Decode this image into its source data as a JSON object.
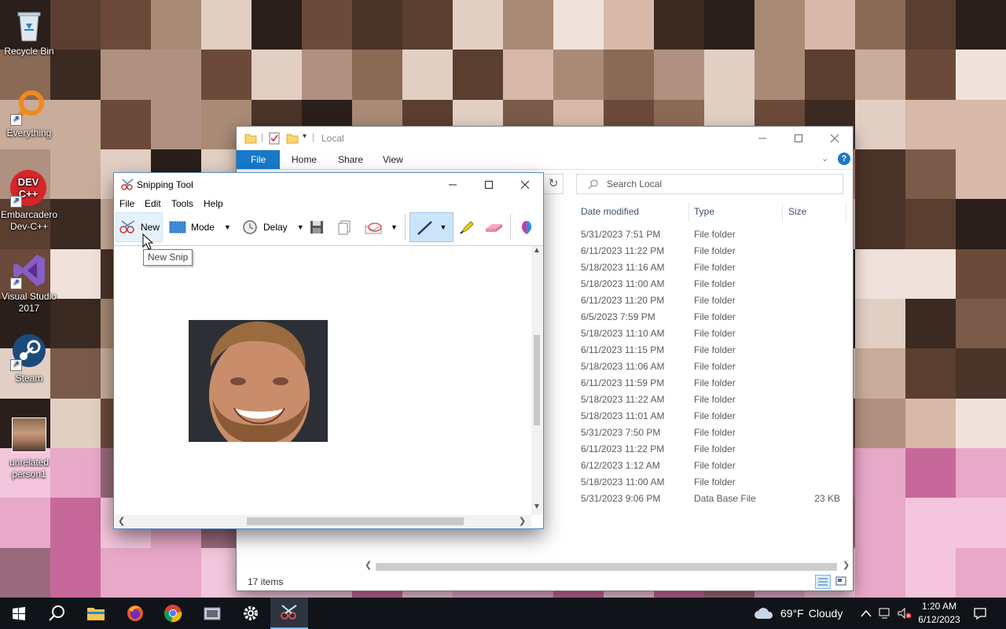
{
  "desktop": {
    "icons": [
      {
        "label": "Recycle Bin",
        "icon": "recycle-bin-icon"
      },
      {
        "label": "Everything",
        "icon": "everything-search-icon"
      },
      {
        "label": "Embarcadero Dev-C++",
        "icon": "devcpp-icon",
        "text": "DEV C++"
      },
      {
        "label": "Visual Studio 2017",
        "icon": "visual-studio-icon"
      },
      {
        "label": "Steam",
        "icon": "steam-icon"
      },
      {
        "label": "unrelated person1",
        "icon": "image-file-icon"
      }
    ]
  },
  "explorer": {
    "title": "Local",
    "ribbon_tabs": [
      "File",
      "Home",
      "Share",
      "View"
    ],
    "search_placeholder": "Search Local",
    "columns": [
      "Date modified",
      "Type",
      "Size"
    ],
    "rows": [
      {
        "date": "5/31/2023 7:51 PM",
        "type": "File folder",
        "size": ""
      },
      {
        "date": "6/11/2023 11:22 PM",
        "type": "File folder",
        "size": ""
      },
      {
        "date": "5/18/2023 11:16 AM",
        "type": "File folder",
        "size": ""
      },
      {
        "date": "5/18/2023 11:00 AM",
        "type": "File folder",
        "size": ""
      },
      {
        "date": "6/11/2023 11:20 PM",
        "type": "File folder",
        "size": ""
      },
      {
        "date": "6/5/2023 7:59 PM",
        "type": "File folder",
        "size": ""
      },
      {
        "date": "5/18/2023 11:10 AM",
        "type": "File folder",
        "size": ""
      },
      {
        "date": "6/11/2023 11:15 PM",
        "type": "File folder",
        "size": ""
      },
      {
        "date": "5/18/2023 11:06 AM",
        "type": "File folder",
        "size": ""
      },
      {
        "date": "6/11/2023 11:59 PM",
        "type": "File folder",
        "size": ""
      },
      {
        "date": "5/18/2023 11:22 AM",
        "type": "File folder",
        "size": ""
      },
      {
        "date": "5/18/2023 11:01 AM",
        "type": "File folder",
        "size": ""
      },
      {
        "date": "5/31/2023 7:50 PM",
        "type": "File folder",
        "size": ""
      },
      {
        "date": "6/11/2023 11:22 PM",
        "type": "File folder",
        "size": ""
      },
      {
        "date": "6/12/2023 1:12 AM",
        "type": "File folder",
        "size": ""
      },
      {
        "date": "5/18/2023 11:00 AM",
        "type": "File folder",
        "size": ""
      },
      {
        "date": "5/31/2023 9:06 PM",
        "type": "Data Base File",
        "size": "23 KB"
      }
    ],
    "status": "17 items"
  },
  "snipping_tool": {
    "title": "Snipping Tool",
    "menu": [
      "File",
      "Edit",
      "Tools",
      "Help"
    ],
    "toolbar": {
      "new_label": "New",
      "mode_label": "Mode",
      "delay_label": "Delay"
    },
    "tooltip": "New Snip"
  },
  "taskbar": {
    "weather_temp": "69°F",
    "weather_desc": "Cloudy",
    "time": "1:20 AM",
    "date": "6/12/2023",
    "apps": [
      "file-explorer-icon",
      "firefox-icon",
      "chrome-icon",
      "media-icon",
      "settings-icon",
      "snipping-tool-icon"
    ]
  },
  "colors": {
    "accent": "#1979ca",
    "taskbar": "#101418",
    "selected_tool": "#cce4f7"
  }
}
